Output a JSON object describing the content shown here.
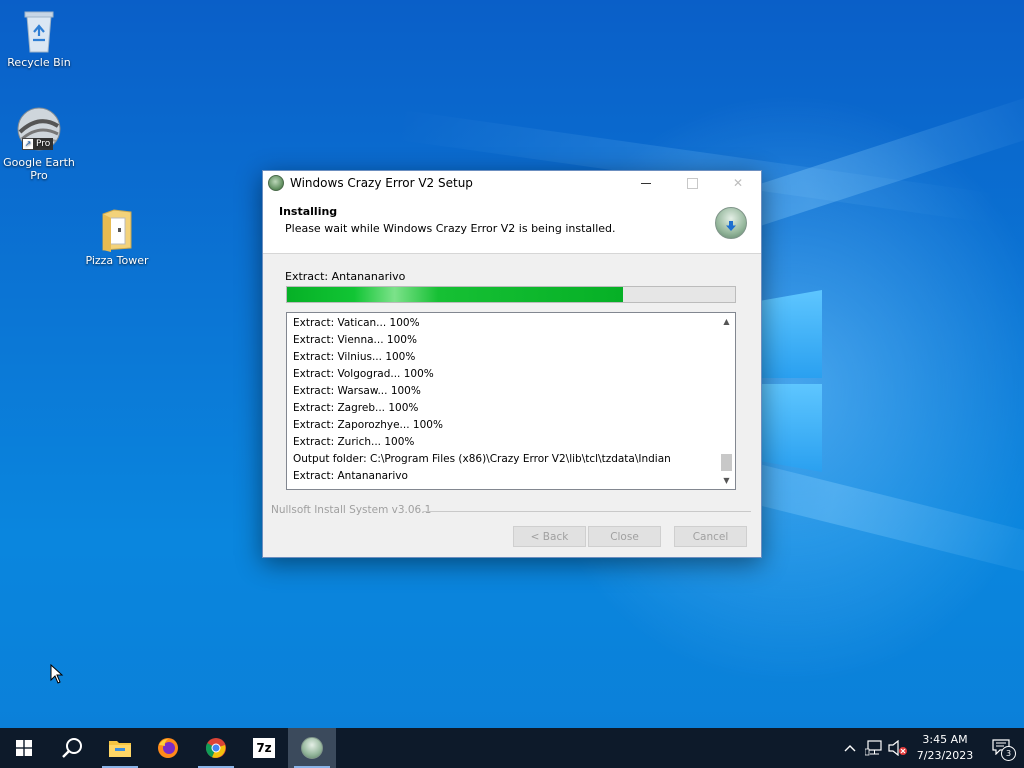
{
  "desktop": {
    "icons": [
      {
        "label": "Recycle Bin"
      },
      {
        "label": "Google Earth Pro",
        "badge": "Pro"
      },
      {
        "label": "Pizza Tower"
      }
    ]
  },
  "dialog": {
    "title": "Windows Crazy Error V2 Setup",
    "controls": {
      "minimize": "—",
      "maximize": "☐",
      "close": "✕"
    },
    "header_title": "Installing",
    "header_subtitle": "Please wait while Windows Crazy Error V2 is being installed.",
    "status_label": "Extract: Antananarivo",
    "progress_percent": 75,
    "log_lines": [
      "Extract: Vatican... 100%",
      "Extract: Vienna... 100%",
      "Extract: Vilnius... 100%",
      "Extract: Volgograd... 100%",
      "Extract: Warsaw... 100%",
      "Extract: Zagreb... 100%",
      "Extract: Zaporozhye... 100%",
      "Extract: Zurich... 100%",
      "Output folder: C:\\Program Files (x86)\\Crazy Error V2\\lib\\tcl\\tzdata\\Indian",
      "Extract: Antananarivo"
    ],
    "branding": "Nullsoft Install System v3.06.1",
    "buttons": {
      "back": "< Back",
      "close": "Close",
      "cancel": "Cancel"
    }
  },
  "taskbar": {
    "items": [
      "start-icon",
      "search-icon",
      "file-explorer-icon",
      "firefox-icon",
      "chrome-icon",
      "7zip-icon",
      "installer-icon"
    ],
    "sevenzip_label": "7z",
    "clock_time": "3:45 AM",
    "clock_date": "7/23/2023",
    "notification_count": "3"
  }
}
